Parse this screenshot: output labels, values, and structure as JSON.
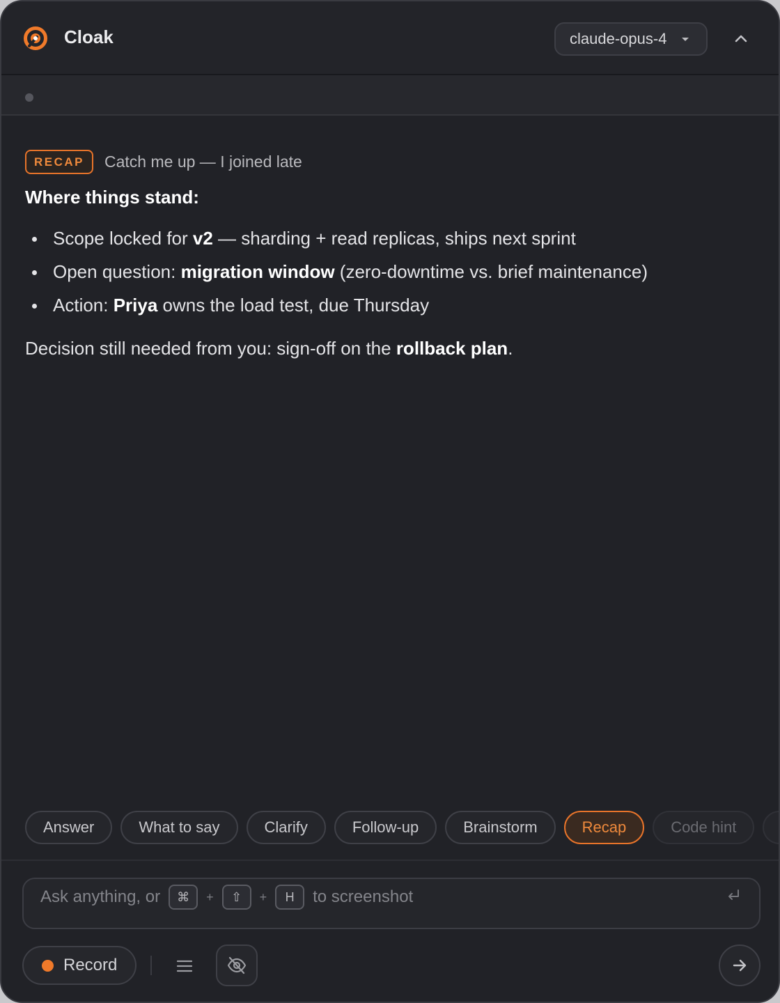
{
  "app": {
    "title": "Cloak",
    "accent": "#f07a2a"
  },
  "header": {
    "model_value": "claude-opus-4"
  },
  "response": {
    "badge": "RECAP",
    "prompt": "Catch me up — I joined late",
    "heading": "Where things stand:",
    "bullets": [
      {
        "pre": "Scope locked for ",
        "bold": "v2",
        "post": " — sharding + read replicas, ships next sprint"
      },
      {
        "pre": "Open question: ",
        "bold": "migration window",
        "post": " (zero-downtime vs. brief maintenance)"
      },
      {
        "pre": "Action: ",
        "bold": "Priya",
        "post": " owns the load test, due Thursday"
      }
    ],
    "decision": {
      "pre": "Decision still needed from you: sign-off on the ",
      "bold": "rollback plan",
      "post": "."
    }
  },
  "chips": [
    {
      "label": "Answer",
      "state": "normal"
    },
    {
      "label": "What to say",
      "state": "normal"
    },
    {
      "label": "Clarify",
      "state": "normal"
    },
    {
      "label": "Follow-up",
      "state": "normal"
    },
    {
      "label": "Brainstorm",
      "state": "normal"
    },
    {
      "label": "Recap",
      "state": "active"
    },
    {
      "label": "Code hint",
      "state": "dim"
    },
    {
      "label": "",
      "state": "dim"
    }
  ],
  "input": {
    "hint_prefix": "Ask anything, or",
    "keys": [
      "⌘",
      "⇧",
      "H"
    ],
    "plus": "+",
    "hint_suffix": "to screenshot"
  },
  "bottom": {
    "record_label": "Record"
  },
  "icons": {
    "logo": "cloak-logo-icon",
    "caret": "chevron-down-icon",
    "collapse": "chevron-up-icon",
    "enter": "enter-icon",
    "menu": "menu-icon",
    "hide": "eye-off-icon",
    "send": "arrow-right-icon"
  }
}
